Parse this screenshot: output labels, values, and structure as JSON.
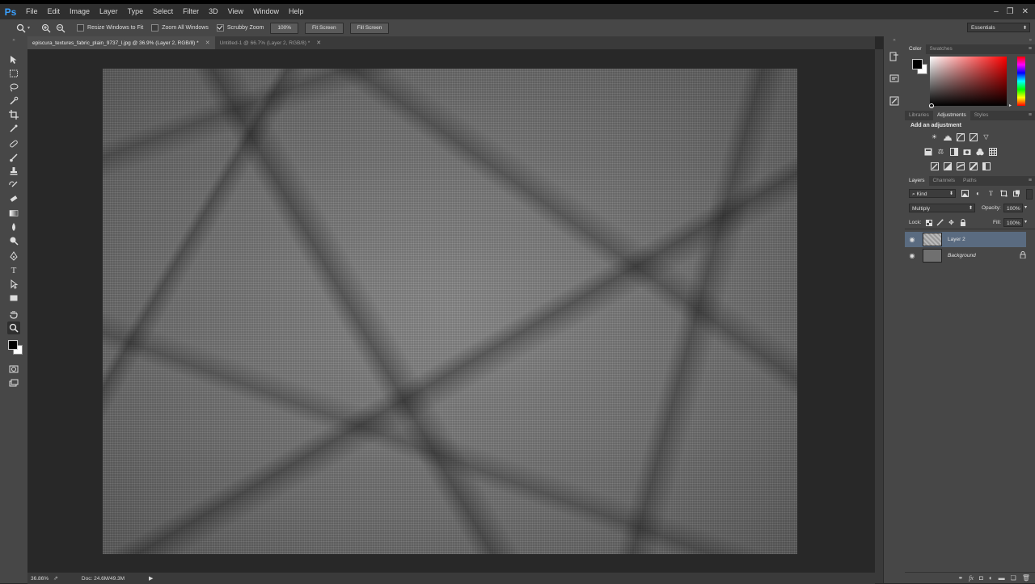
{
  "app": {
    "logo": "Ps"
  },
  "menu": [
    "File",
    "Edit",
    "Image",
    "Layer",
    "Type",
    "Select",
    "Filter",
    "3D",
    "View",
    "Window",
    "Help"
  ],
  "window_controls": {
    "minimize": "–",
    "restore": "❐",
    "close": "✕"
  },
  "options_bar": {
    "resize_windows": "Resize Windows to Fit",
    "zoom_all": "Zoom All Windows",
    "scrubby_zoom": "Scrubby Zoom",
    "zoom_100": "100%",
    "fit_screen": "Fit Screen",
    "fill_screen": "Fill Screen",
    "workspace": "Essentials",
    "checks": {
      "resize_windows": false,
      "zoom_all": false,
      "scrubby_zoom": true
    }
  },
  "tabs": [
    {
      "label": "episcura_textures_fabric_plain_9737_l.jpg @ 36.9% (Layer 2, RGB/8) *",
      "active": true
    },
    {
      "label": "Untitled-1 @ 66.7% (Layer 2, RGB/8) *",
      "active": false
    }
  ],
  "status": {
    "zoom": "36.86%",
    "doc": "Doc: 24.6M/49.3M"
  },
  "color_panel": {
    "tabs": [
      "Color",
      "Swatches"
    ],
    "foreground": "#000000",
    "background": "#ffffff"
  },
  "adjust_panel": {
    "tabs": [
      "Libraries",
      "Adjustments",
      "Styles"
    ],
    "heading": "Add an adjustment"
  },
  "layers_panel": {
    "tabs": [
      "Layers",
      "Channels",
      "Paths"
    ],
    "kind": "Kind",
    "blend_mode": "Multiply",
    "opacity_label": "Opacity:",
    "opacity": "100%",
    "lock_label": "Lock:",
    "fill_label": "Fill:",
    "fill": "100%",
    "layers": [
      {
        "name": "Layer 2",
        "selected": true
      },
      {
        "name": "Background",
        "selected": false,
        "locked": true
      }
    ]
  },
  "colors": {
    "accent": "#3aa0ff",
    "selected_layer": "#5a6b80"
  }
}
